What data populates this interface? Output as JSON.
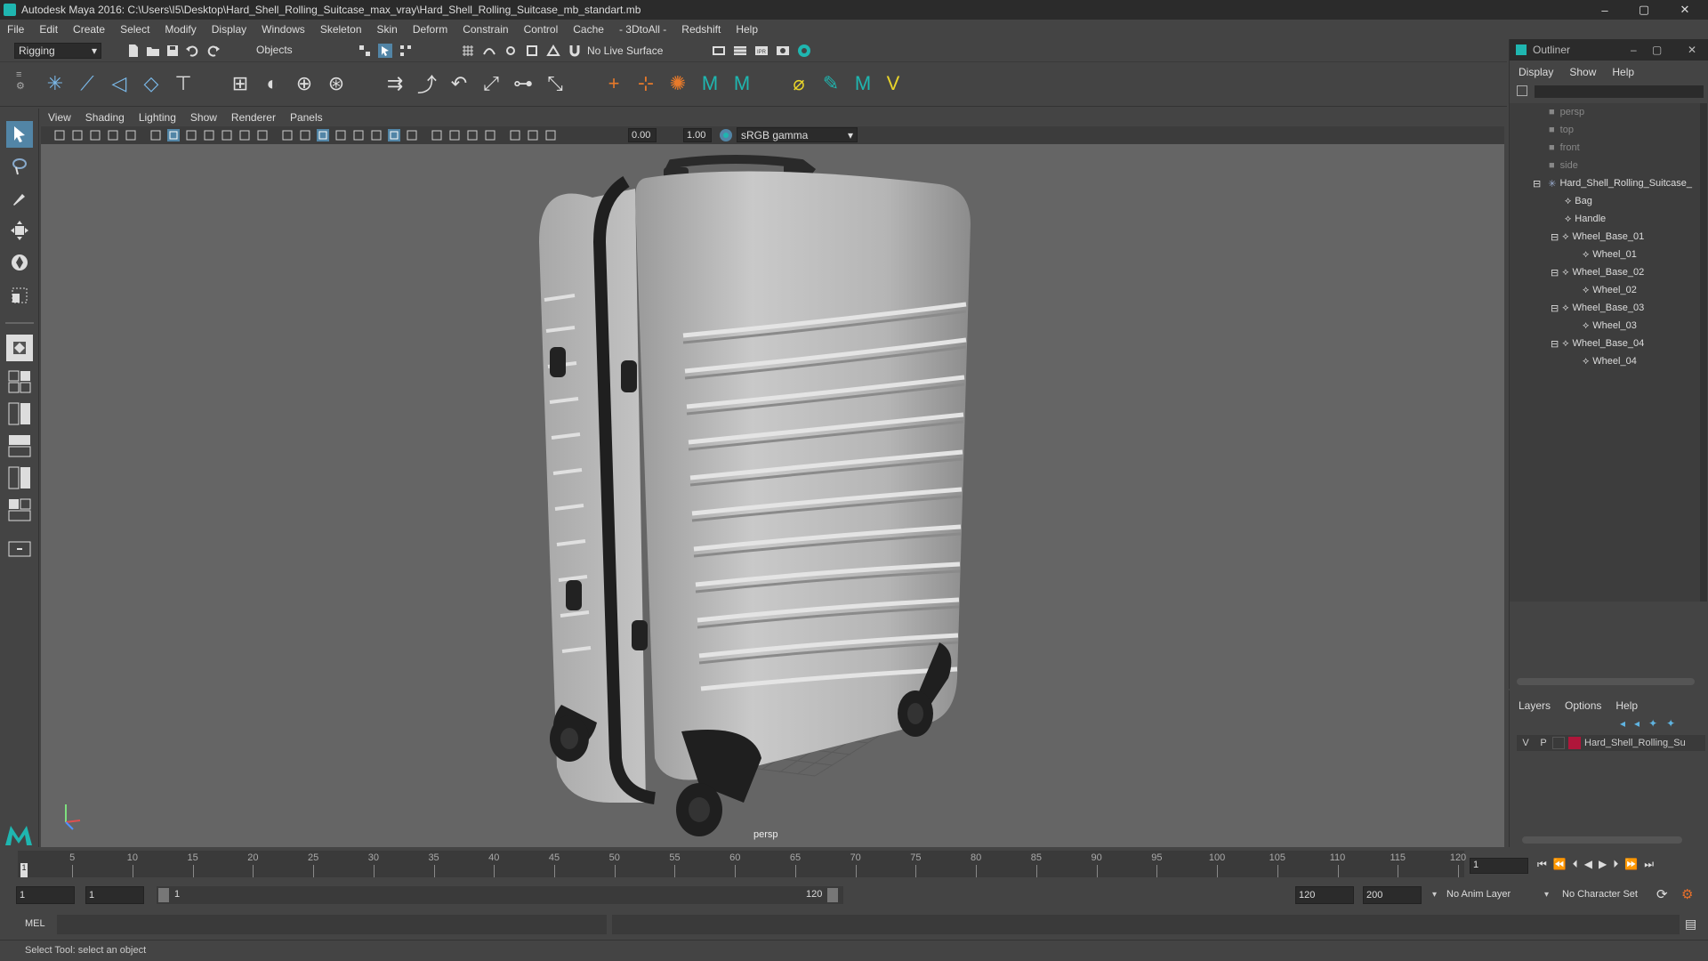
{
  "window": {
    "title": "Autodesk Maya 2016: C:\\Users\\I5\\Desktop\\Hard_Shell_Rolling_Suitcase_max_vray\\Hard_Shell_Rolling_Suitcase_mb_standart.mb",
    "minimize": "–",
    "maximize": "▢",
    "close": "✕"
  },
  "menubar": [
    "File",
    "Edit",
    "Create",
    "Select",
    "Modify",
    "Display",
    "Windows",
    "Skeleton",
    "Skin",
    "Deform",
    "Constrain",
    "Control",
    "Cache",
    "- 3DtoAll -",
    "Redshift",
    "Help"
  ],
  "statusline": {
    "menuset": "Rigging",
    "selection_mode": "Objects",
    "live_surface": "No Live Surface"
  },
  "viewport": {
    "menus": [
      "View",
      "Shading",
      "Lighting",
      "Show",
      "Renderer",
      "Panels"
    ],
    "exposure": "0.00",
    "gamma": "1.00",
    "color_space": "sRGB gamma",
    "camera_label": "persp"
  },
  "outliner": {
    "title": "Outliner",
    "menus": [
      "Display",
      "Show",
      "Help"
    ],
    "items": [
      {
        "label": "persp",
        "type": "camera"
      },
      {
        "label": "top",
        "type": "camera"
      },
      {
        "label": "front",
        "type": "camera"
      },
      {
        "label": "side",
        "type": "camera"
      },
      {
        "label": "Hard_Shell_Rolling_Suitcase_",
        "type": "group"
      },
      {
        "label": "Bag",
        "type": "mesh"
      },
      {
        "label": "Handle",
        "type": "mesh"
      },
      {
        "label": "Wheel_Base_01",
        "type": "mesh"
      },
      {
        "label": "Wheel_01",
        "type": "mesh"
      },
      {
        "label": "Wheel_Base_02",
        "type": "mesh"
      },
      {
        "label": "Wheel_02",
        "type": "mesh"
      },
      {
        "label": "Wheel_Base_03",
        "type": "mesh"
      },
      {
        "label": "Wheel_03",
        "type": "mesh"
      },
      {
        "label": "Wheel_Base_04",
        "type": "mesh"
      },
      {
        "label": "Wheel_04",
        "type": "mesh"
      }
    ]
  },
  "layers": {
    "menus": [
      "Layers",
      "Options",
      "Help"
    ],
    "layer": {
      "v": "V",
      "p": "P",
      "name": "Hard_Shell_Rolling_Su",
      "color": "#b0163a"
    }
  },
  "timeslider": {
    "ticks": [
      "5",
      "10",
      "15",
      "20",
      "25",
      "30",
      "35",
      "40",
      "45",
      "50",
      "55",
      "60",
      "65",
      "70",
      "75",
      "80",
      "85",
      "90",
      "95",
      "100",
      "105",
      "110",
      "115",
      "120"
    ],
    "current_marker": "1",
    "current_frame": "1"
  },
  "range": {
    "start": "1",
    "playback_start": "1",
    "slider_start": "1",
    "slider_end": "120",
    "playback_end": "120",
    "end": "200",
    "anim_layer": "No Anim Layer",
    "character_set": "No Character Set"
  },
  "cmdline": {
    "label": "MEL"
  },
  "helpline": {
    "text": "Select Tool: select an object"
  },
  "colors": {
    "accent": "#5285a6",
    "maya_teal": "#1fb6b0"
  }
}
